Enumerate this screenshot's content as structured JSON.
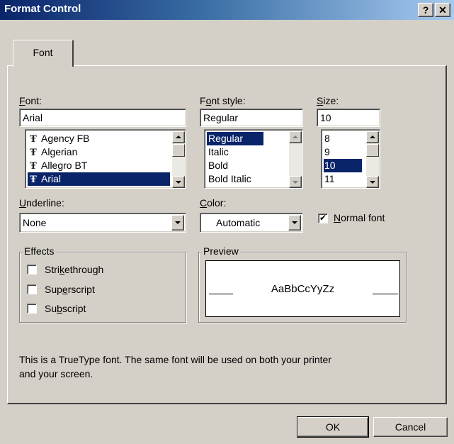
{
  "window": {
    "title": "Format Control",
    "help_label": "?",
    "close_label": "✕"
  },
  "tabs": [
    {
      "label": "Font"
    }
  ],
  "font": {
    "label": "Font:",
    "value": "Arial",
    "items": [
      {
        "label": "Agency FB",
        "icon": "truetype-icon"
      },
      {
        "label": "Algerian",
        "icon": "truetype-icon"
      },
      {
        "label": "Allegro BT",
        "icon": "truetype-icon"
      },
      {
        "label": "Arial",
        "icon": "truetype-icon",
        "selected": true
      }
    ]
  },
  "font_style": {
    "label": "Font style:",
    "value": "Regular",
    "items": [
      {
        "label": "Regular",
        "selected": true
      },
      {
        "label": "Italic"
      },
      {
        "label": "Bold"
      },
      {
        "label": "Bold Italic"
      }
    ]
  },
  "size": {
    "label": "Size:",
    "value": "10",
    "items": [
      {
        "label": "8"
      },
      {
        "label": "9"
      },
      {
        "label": "10",
        "selected": true
      },
      {
        "label": "11"
      }
    ]
  },
  "underline": {
    "label": "Underline:",
    "value": "None"
  },
  "color": {
    "label": "Color:",
    "value": "Automatic"
  },
  "normal_font": {
    "label": "Normal font",
    "checked": true
  },
  "effects": {
    "legend": "Effects",
    "options": [
      {
        "label": "Strikethrough",
        "checked": false
      },
      {
        "label": "Superscript",
        "checked": false
      },
      {
        "label": "Subscript",
        "checked": false
      }
    ]
  },
  "preview": {
    "legend": "Preview",
    "sample": "AaBbCcYyZz"
  },
  "info_text_line1": "This is a TrueType font.  The same font will be used on both your printer",
  "info_text_line2": "and your screen.",
  "buttons": {
    "ok": "OK",
    "cancel": "Cancel"
  },
  "colors": {
    "titlebar_start": "#0a246a",
    "titlebar_end": "#a6caf0",
    "face": "#d4d0c8",
    "selection": "#0a246a"
  }
}
